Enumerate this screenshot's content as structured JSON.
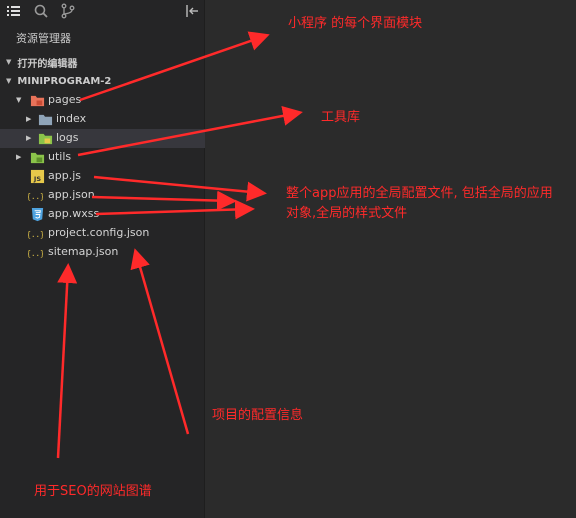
{
  "explorer": {
    "title": "资源管理器",
    "open_editors": "打开的编辑器",
    "project": "MINIPROGRAM-2",
    "tree": {
      "pages": "pages",
      "index": "index",
      "logs": "logs",
      "utils": "utils",
      "app_js": "app.js",
      "app_json": "app.json",
      "app_wxss": "app.wxss",
      "project_config": "project.config.json",
      "sitemap": "sitemap.json"
    },
    "icon_text": {
      "js": "JS",
      "json": "{..}"
    }
  },
  "annotations": {
    "pages_note": "小程序 的每个界面模块",
    "utils_note": "工具库",
    "app_note_line1": "整个app应用的全局配置文件, 包括全局的应用",
    "app_note_line2": "对象,全局的样式文件",
    "project_config_note": "项目的配置信息",
    "sitemap_note": "用于SEO的网站图谱"
  },
  "colors": {
    "annotation": "#ff2a2a",
    "panel_bg": "#252526",
    "editor_bg": "#2b2b2b",
    "selected_row": "#37373d",
    "folder_pages": "#e8735a",
    "folder_green": "#8bc34a",
    "folder_gray": "#8fa4b8",
    "js_icon": "#e6c84a",
    "json_icon": "#e6c84a",
    "wxss_icon": "#4fa3e0"
  }
}
